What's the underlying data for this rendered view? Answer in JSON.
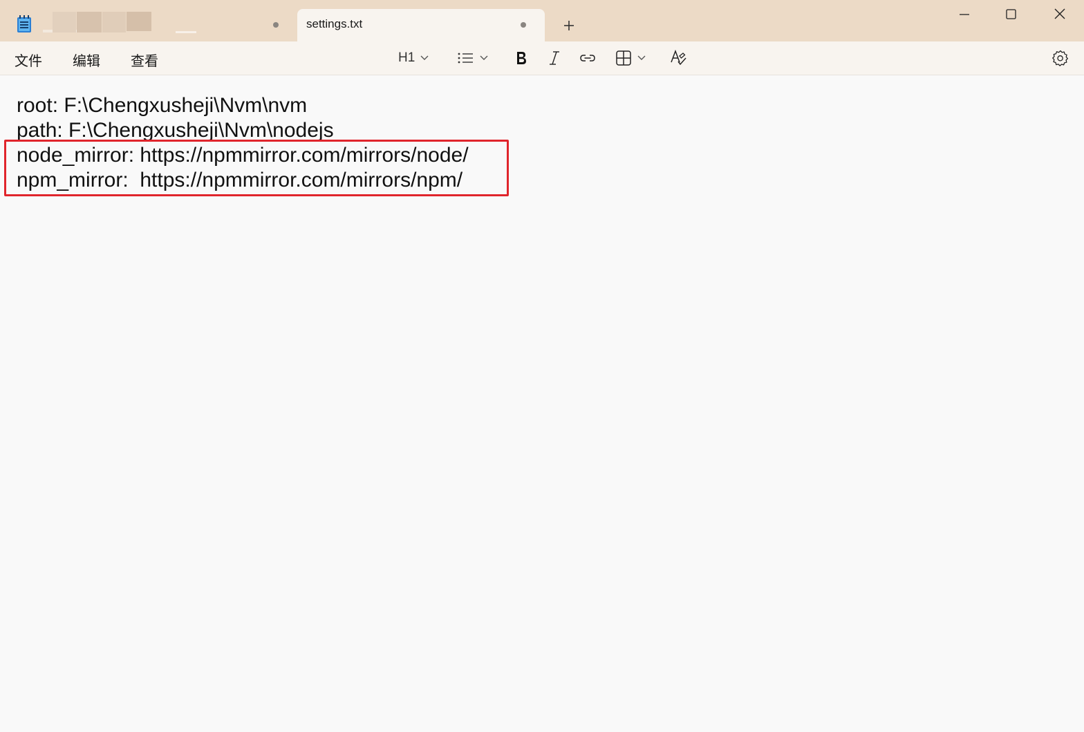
{
  "tabs": [
    {
      "label": "",
      "modified": true,
      "redacted": true
    },
    {
      "label": "settings.txt",
      "modified": true,
      "active": true
    }
  ],
  "menu": {
    "file": "文件",
    "edit": "编辑",
    "view": "查看"
  },
  "toolbar": {
    "heading": "H1",
    "icons": [
      "list-icon",
      "bold-icon",
      "italic-icon",
      "link-icon",
      "table-icon",
      "spellcheck-icon",
      "settings-gear-icon"
    ]
  },
  "document": {
    "lines": [
      "root: F:\\Chengxusheji\\Nvm\\nvm",
      "path: F:\\Chengxusheji\\Nvm\\nodejs",
      "node_mirror: https://npmmirror.com/mirrors/node/",
      "npm_mirror:  https://npmmirror.com/mirrors/npm/"
    ]
  },
  "colors": {
    "titlebar": "#ecdac6",
    "menubar": "#f8f4ef",
    "editor_bg": "#f9f9f9",
    "highlight_border": "#e0252c"
  }
}
